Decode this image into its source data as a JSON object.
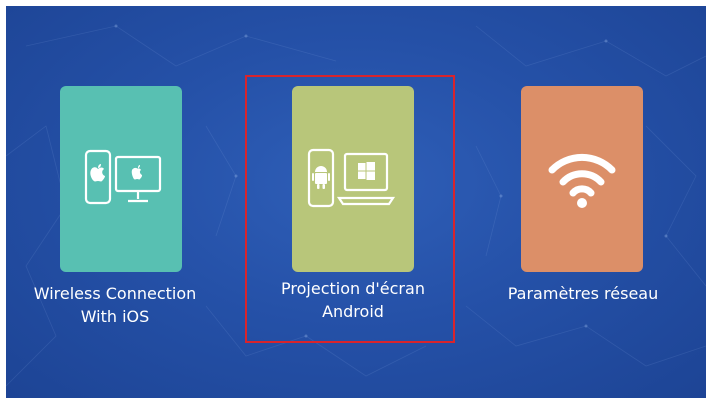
{
  "tiles": [
    {
      "label_line1": "Wireless Connection",
      "label_line2": "With iOS",
      "icon": "apple-devices-icon",
      "color": "#58c0b2"
    },
    {
      "label_line1": "Projection d'écran",
      "label_line2": "Android",
      "icon": "android-windows-icon",
      "color": "#b8c67a",
      "selected": true
    },
    {
      "label_line1": "Paramètres réseau",
      "label_line2": "",
      "icon": "wifi-icon",
      "color": "#dc8f68"
    }
  ],
  "colors": {
    "background": "#2551a8",
    "selection": "#d8242c",
    "text": "#ffffff"
  }
}
